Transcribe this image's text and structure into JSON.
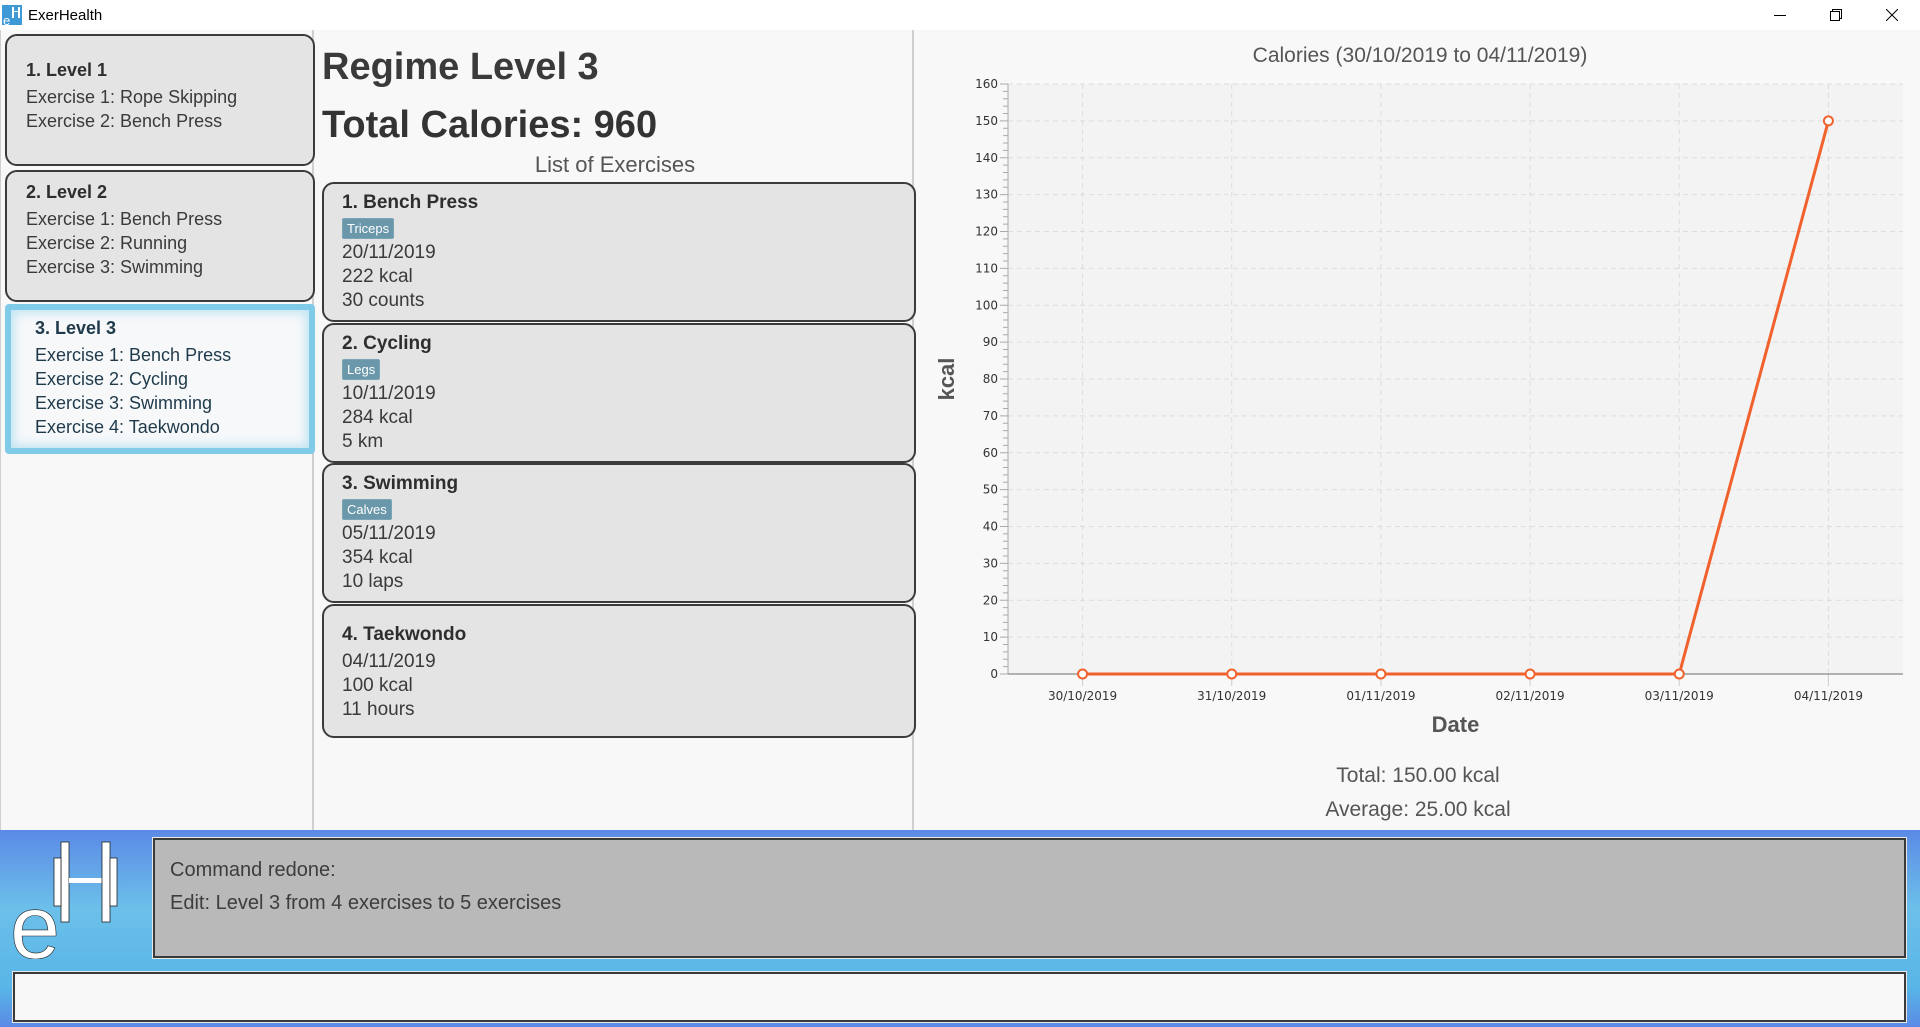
{
  "window": {
    "title": "ExerHealth",
    "controls": [
      "minimize",
      "restore",
      "close"
    ]
  },
  "regimes": [
    {
      "title": "1.  Level 1",
      "exercises": [
        "Exercise 1: Rope Skipping",
        "Exercise 2: Bench Press"
      ],
      "selected": false
    },
    {
      "title": "2.  Level 2",
      "exercises": [
        "Exercise 1: Bench Press",
        "Exercise 2: Running",
        "Exercise 3: Swimming"
      ],
      "selected": false
    },
    {
      "title": "3.  Level 3",
      "exercises": [
        "Exercise 1: Bench Press",
        "Exercise 2: Cycling",
        "Exercise 3: Swimming",
        "Exercise 4: Taekwondo"
      ],
      "selected": true
    }
  ],
  "detail": {
    "regime_title": "Regime Level 3",
    "total_calories": "Total Calories: 960",
    "list_label": "List of Exercises",
    "exercises": [
      {
        "title": "1.  Bench Press",
        "tag": "Triceps",
        "date": "20/11/2019",
        "calories": "222 kcal",
        "quantity": "30 counts"
      },
      {
        "title": "2.  Cycling",
        "tag": "Legs",
        "date": "10/11/2019",
        "calories": "284 kcal",
        "quantity": "5 km"
      },
      {
        "title": "3.  Swimming",
        "tag": "Calves",
        "date": "05/11/2019",
        "calories": "354 kcal",
        "quantity": "10 laps"
      },
      {
        "title": "4.  Taekwondo",
        "tag": null,
        "date": "04/11/2019",
        "calories": "100 kcal",
        "quantity": "11 hours"
      }
    ]
  },
  "chart_data": {
    "type": "line",
    "title": "Calories (30/10/2019 to 04/11/2019)",
    "xlabel": "Date",
    "ylabel": "kcal",
    "categories": [
      "30/10/2019",
      "31/10/2019",
      "01/11/2019",
      "02/11/2019",
      "03/11/2019",
      "04/11/2019"
    ],
    "series": [
      {
        "name": "Calories",
        "values": [
          0,
          0,
          0,
          0,
          0,
          150
        ]
      }
    ],
    "ylim": [
      0,
      160
    ],
    "y_major_step": 10,
    "y_minor_step": 2,
    "grid": true,
    "legend": "none",
    "line_color": "#f0612d"
  },
  "stats": {
    "total": "Total: 150.00 kcal",
    "average": "Average: 25.00 kcal"
  },
  "result_display": {
    "lines": [
      "Command redone:",
      "Edit: Level 3 from 4 exercises to 5 exercises"
    ]
  },
  "command_box": {
    "value": "",
    "placeholder": ""
  }
}
